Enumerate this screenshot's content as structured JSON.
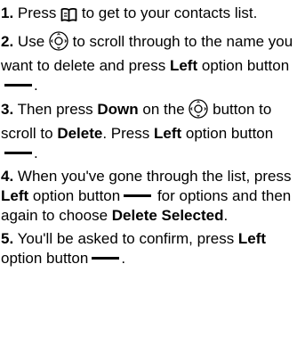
{
  "steps": [
    {
      "num": "1.",
      "t1": "Press",
      "icon": "contacts-book-icon",
      "t2": "to get to your contacts list."
    },
    {
      "num": "2.",
      "t1": "Use",
      "icon": "nav-pad-icon",
      "t2": "to scroll through to the name you want to delete and press",
      "b1": "Left",
      "t3": "option button",
      "end": "."
    },
    {
      "num": "3.",
      "t1": "Then press",
      "b1": "Down",
      "t2": "on the",
      "icon": "nav-pad-icon",
      "t3": "button to scroll to",
      "b2": "Delete",
      "t4": ". Press",
      "b3": "Left",
      "t5": "option button",
      "end": "."
    },
    {
      "num": "4.",
      "t1": "When you've gone through the list, press",
      "b1": "Left",
      "t2": "option button",
      "t3": "for options and then again to choose",
      "b2": "Delete Selected",
      "end": "."
    },
    {
      "num": "5.",
      "t1": "You'll be asked to confirm, press",
      "b1": "Left",
      "t2": "option button",
      "end": "."
    }
  ]
}
